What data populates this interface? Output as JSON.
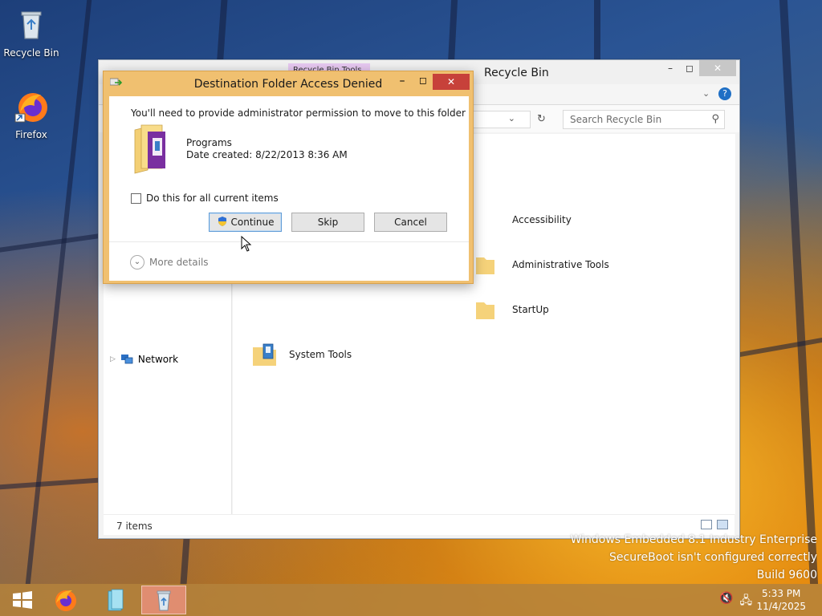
{
  "desktop": {
    "icons": [
      {
        "label": "Recycle Bin"
      },
      {
        "label": "Firefox"
      }
    ],
    "watermark": {
      "line1": "Windows Embedded 8.1 Industry Enterprise",
      "line2": "SecureBoot isn't configured correctly",
      "line3": "Build 9600"
    }
  },
  "explorer": {
    "title": "Recycle Bin",
    "tool_tab": "Recycle Bin Tools",
    "search_placeholder": "Search Recycle Bin",
    "nav": {
      "network_label": "Network"
    },
    "items": [
      {
        "name": "Accessibility"
      },
      {
        "name": "Administrative Tools"
      },
      {
        "name": "StartUp"
      },
      {
        "name": "System Tools"
      }
    ],
    "status": {
      "count": "7 items"
    }
  },
  "dialog": {
    "title": "Destination Folder Access Denied",
    "message": "You'll need to provide administrator permission to move to this folder",
    "folder_name": "Programs",
    "folder_date": "Date created: 8/22/2013 8:36 AM",
    "checkbox_label": "Do this for all current items",
    "checkbox_checked": false,
    "buttons": {
      "continue": "Continue",
      "skip": "Skip",
      "cancel": "Cancel"
    },
    "more_details": "More details"
  },
  "taskbar": {
    "time": "5:33 PM",
    "date": "11/4/2025"
  },
  "colors": {
    "dialog_frame": "#f0c070",
    "close_red": "#c7413a",
    "taskbar": "#b4823c"
  }
}
